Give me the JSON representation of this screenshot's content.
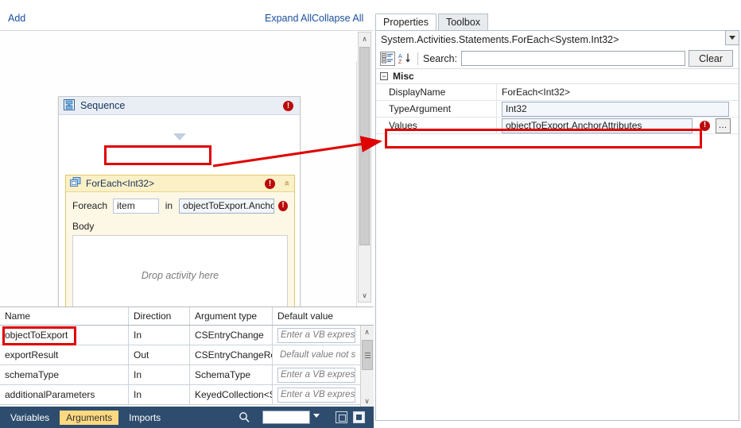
{
  "designer": {
    "toolbar": {
      "add_label": "Add",
      "expand_all_label": "Expand All",
      "collapse_all_label": "Collapse All"
    },
    "sequence": {
      "title": "Sequence",
      "error_glyph": "!",
      "icon_name": "sequence-icon"
    },
    "foreach": {
      "title": "ForEach<Int32>",
      "error_glyph": "!",
      "collapse_glyph": "«",
      "foreach_label": "Foreach",
      "item_value": "item",
      "in_label": "in",
      "values_expression": "objectToExport.Anchor",
      "values_error_glyph": "!",
      "body_label": "Body",
      "drop_hint": "Drop activity here"
    },
    "scrollbar": {
      "up_glyph": "∧",
      "down_glyph": "∨"
    }
  },
  "arguments_table": {
    "columns": [
      "Name",
      "Direction",
      "Argument type",
      "Default value"
    ],
    "rows": [
      {
        "name": "objectToExport",
        "direction": "In",
        "type": "CSEntryChange",
        "default": "Enter a VB express",
        "default_boxed": true
      },
      {
        "name": "exportResult",
        "direction": "Out",
        "type": "CSEntryChangeRes",
        "default": "Default value not su",
        "default_boxed": false
      },
      {
        "name": "schemaType",
        "direction": "In",
        "type": "SchemaType",
        "default": "Enter a VB express",
        "default_boxed": true
      },
      {
        "name": "additionalParameters",
        "direction": "In",
        "type": "KeyedCollection<S",
        "default": "Enter a VB express",
        "default_boxed": true
      }
    ],
    "scrollbar": {
      "up_glyph": "∧",
      "down_glyph": "∨"
    }
  },
  "bottom_strip": {
    "tabs": [
      {
        "label": "Variables",
        "active": false
      },
      {
        "label": "Arguments",
        "active": true
      },
      {
        "label": "Imports",
        "active": false
      }
    ],
    "search_icon_name": "search-icon",
    "search_value": "",
    "zoom_dropdown_icon": "chevron-down-icon",
    "fit_to_screen_icon": "fit-to-screen-icon",
    "restore_icon": "restore-icon"
  },
  "properties": {
    "tabs": [
      {
        "label": "Properties",
        "active": true
      },
      {
        "label": "Toolbox",
        "active": false
      }
    ],
    "type_line": "System.Activities.Statements.ForEach<System.Int32>",
    "toolbar": {
      "categorized_icon": "categorized-view-icon",
      "sort_icon": "sort-alphabetical-icon",
      "search_label": "Search:",
      "search_value": "",
      "search_placeholder": "",
      "clear_label": "Clear"
    },
    "category": {
      "toggle_glyph": "−",
      "name": "Misc"
    },
    "rows": [
      {
        "name": "DisplayName",
        "value": "ForEach<Int32>",
        "style": "plain"
      },
      {
        "name": "TypeArgument",
        "value": "Int32",
        "style": "dropdown"
      },
      {
        "name": "Values",
        "value": "objectToExport.AnchorAttributes",
        "style": "error",
        "error_glyph": "!",
        "ellipsis_label": "…"
      }
    ]
  },
  "annotations": {
    "highlight_color": "#e00000",
    "connector_name": "red-arrow-connector"
  }
}
